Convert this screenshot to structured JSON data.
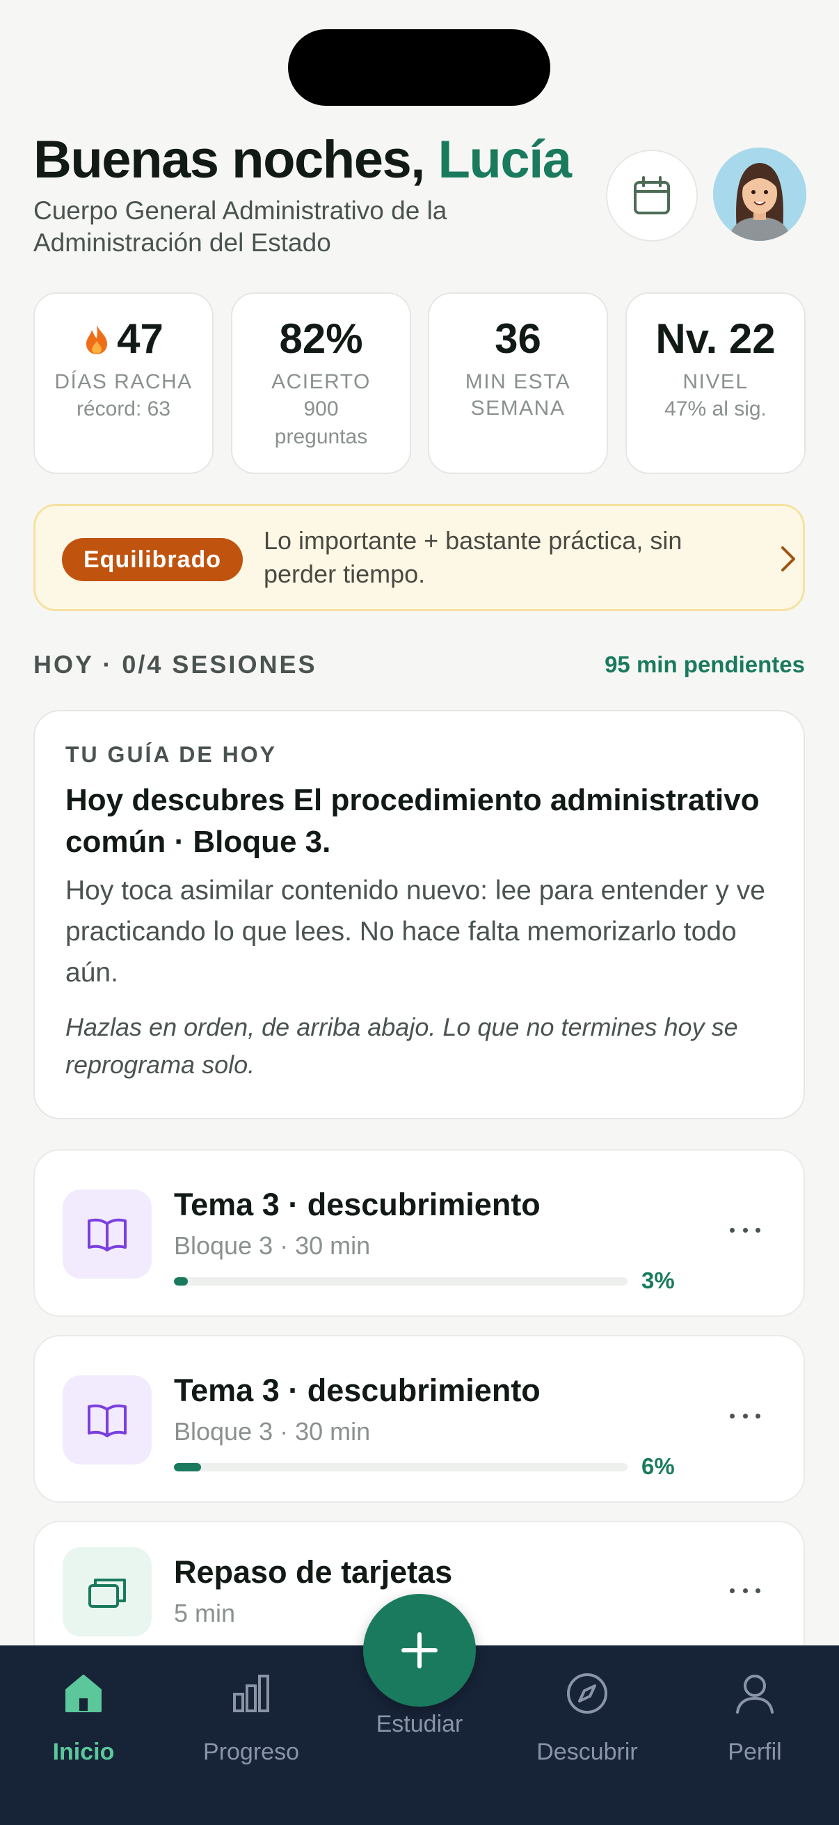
{
  "header": {
    "greeting": "Buenas noches,",
    "name": "Lucía",
    "subtitle": "Cuerpo General Administrativo de la Administración del Estado",
    "calendar_icon": "calendar-icon",
    "avatar_icon": "user-avatar"
  },
  "stats": [
    {
      "value": "47",
      "icon": "flame-icon",
      "label": "DÍAS RACHA",
      "sub": "récord: 63"
    },
    {
      "value": "82%",
      "label": "ACIERTO",
      "sub": "900 preguntas"
    },
    {
      "value": "36",
      "label": "MIN ESTA SEMANA",
      "sub": ""
    },
    {
      "value": "Nv. 22",
      "label": "NIVEL",
      "sub": "47% al sig."
    }
  ],
  "plan": {
    "badge": "Equilibrado",
    "description": "Lo importante + bastante práctica, sin perder tiempo.",
    "icon": "chevron-right-icon",
    "accent": "#c0530e"
  },
  "today": {
    "title": "HOY · 0/4 SESIONES",
    "pending": "95 min pendientes"
  },
  "guide": {
    "kicker": "TU GUÍA DE HOY",
    "title": "Hoy descubres El procedimiento administrativo común · Bloque 3.",
    "body": "Hoy toca asimilar contenido nuevo: lee para entender y ve practicando lo que lees. No hace falta memorizarlo todo aún.",
    "note": "Hazlas en orden, de arriba abajo. Lo que no termines hoy se reprograma solo."
  },
  "sessions": [
    {
      "title": "Tema 3 · descubrimiento",
      "meta": "Bloque 3 · 30 min",
      "progress": 3,
      "progress_label": "3%",
      "icon": "book-icon"
    },
    {
      "title": "Tema 3 · descubrimiento",
      "meta": "Bloque 3 · 30 min",
      "progress": 6,
      "progress_label": "6%",
      "icon": "book-icon"
    },
    {
      "title": "Repaso de tarjetas",
      "meta": "5 min",
      "icon": "cards-icon"
    }
  ],
  "tabbar": {
    "items": [
      {
        "label": "Inicio",
        "icon": "home-icon",
        "active": true
      },
      {
        "label": "Progreso",
        "icon": "bar-chart-icon"
      },
      {
        "label": "Estudiar",
        "icon": "plus-icon"
      },
      {
        "label": "Descubrir",
        "icon": "compass-icon"
      },
      {
        "label": "Perfil",
        "icon": "person-icon"
      }
    ]
  },
  "colors": {
    "brand_green": "#1a7a5e",
    "tab_active": "#5bc79a",
    "tab_bar_bg": "#172337",
    "background": "#f6f7f5"
  }
}
